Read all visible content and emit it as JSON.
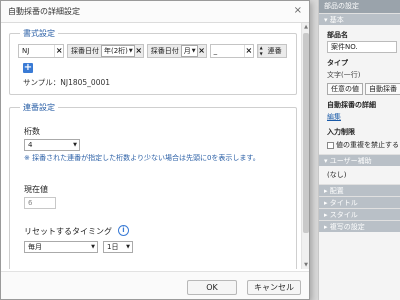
{
  "panel": {
    "title": "部品の設定",
    "section_basic": "基本",
    "part_name_label": "部品名",
    "part_name_value": "案件NO.",
    "type_label": "タイプ",
    "type_value": "文字(一行)",
    "type_btn_any": "任意の値",
    "type_btn_auto": "自動採番",
    "auto_detail_label": "自動採番の詳細",
    "edit_link": "編集",
    "input_limit_label": "入力制限",
    "no_duplicate_label": "値の重複を禁止する",
    "section_user_assist": "ユーザー補助",
    "user_assist_value": "(なし)",
    "section_layout": "配置",
    "section_title": "タイトル",
    "section_style": "スタイル",
    "section_print": "複写の設定"
  },
  "dialog": {
    "title": "自動採番の詳細設定",
    "close": "×",
    "format": {
      "legend": "書式設定",
      "text1_value": "NJ",
      "date1_label": "採番日付",
      "date1_select": "年(2桁)",
      "date2_label": "採番日付",
      "date2_select": "月",
      "text2_value": "_",
      "sequence_label": "連番",
      "remove": "×",
      "add": "+",
      "sample": "サンプル：NJ1805_0001"
    },
    "sequence": {
      "legend": "連番設定",
      "digits_label": "桁数",
      "digits_value": "4",
      "digits_note": "※ 採番された連番が指定した桁数より少ない場合は先頭に0を表示します。",
      "current_label": "現在値",
      "current_value": "6",
      "reset_label": "リセットするタイミング",
      "reset_info": "i",
      "reset_period": "毎月",
      "reset_day": "1日"
    },
    "ok": "OK",
    "cancel": "キャンセル"
  },
  "icons": {
    "arrow": "▼",
    "up": "▲"
  },
  "colors": {
    "accent": "#2a5fa6",
    "add_button": "#3a7bd5"
  }
}
